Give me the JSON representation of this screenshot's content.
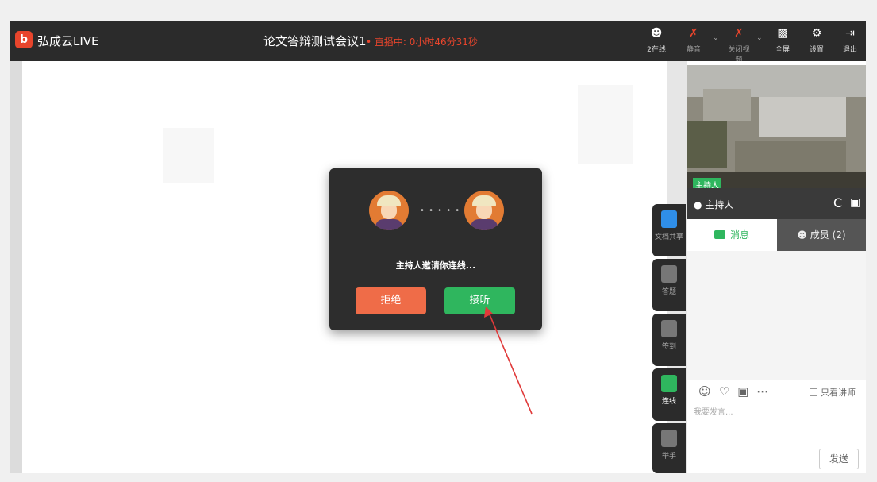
{
  "app": {
    "logo_char": "b",
    "name": "弘成云LIVE"
  },
  "meeting": {
    "title": "论文答辩测试会议1",
    "live_status": "• 直播中: 0小时46分31秒"
  },
  "toolbar": {
    "online": {
      "label": "2在线",
      "icon": "users-icon"
    },
    "mute": {
      "label": "静音",
      "icon": "mic-off-icon"
    },
    "video_off": {
      "label": "关闭视频",
      "icon": "camera-off-icon"
    },
    "fullscreen": {
      "label": "全屏",
      "icon": "fullscreen-icon"
    },
    "settings": {
      "label": "设置",
      "icon": "gear-icon"
    },
    "exit": {
      "label": "退出",
      "icon": "exit-icon"
    }
  },
  "side_tools": [
    {
      "label": "文档共享",
      "icon": "folder-icon",
      "color": "#2f8ee8"
    },
    {
      "label": "答题",
      "icon": "quiz-icon",
      "color": "#777777"
    },
    {
      "label": "签到",
      "icon": "calendar-check-icon",
      "color": "#777777"
    },
    {
      "label": "连线",
      "icon": "phone-icon",
      "color": "#2fb65e"
    },
    {
      "label": "举手",
      "icon": "hand-icon",
      "color": "#777777"
    }
  ],
  "video": {
    "host_tag": "主持人",
    "host_name": "主持人",
    "refresh_icon": "C",
    "screenshot_icon": "▣"
  },
  "tabs": {
    "messages": "消息",
    "members": "成员 (2)"
  },
  "chat": {
    "only_teacher": "只看讲师",
    "placeholder": "我要发言...",
    "send": "发送"
  },
  "dialog": {
    "dots": "• • • • •",
    "message": "主持人邀请你连线...",
    "reject": "拒绝",
    "accept": "接听"
  },
  "colors": {
    "accent_red": "#e8452c",
    "accent_green": "#2fb65e",
    "reject": "#ef6c48"
  }
}
